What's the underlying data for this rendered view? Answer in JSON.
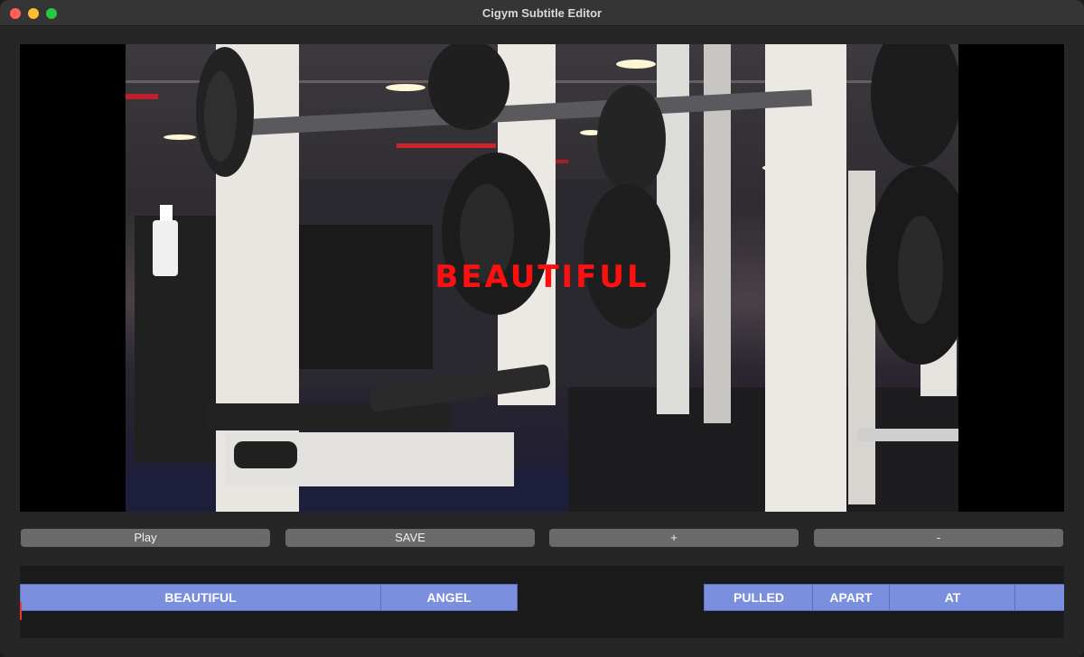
{
  "window": {
    "title": "Cigym Subtitle Editor",
    "controls": [
      "close",
      "minimize",
      "maximize"
    ]
  },
  "video": {
    "subtitle_text": "BEAUTIFUL",
    "subtitle_color": "#ff1010"
  },
  "controls": {
    "play_label": "Play",
    "save_label": "SAVE",
    "add_label": "+",
    "remove_label": "-"
  },
  "timeline": {
    "clips": [
      "BEAUTIFUL",
      "ANGEL",
      "PULLED",
      "APART",
      "AT",
      ""
    ]
  },
  "colors": {
    "clip_fill": "#7b8fdf",
    "button_fill": "#6a6a6a",
    "background": "#262626"
  }
}
